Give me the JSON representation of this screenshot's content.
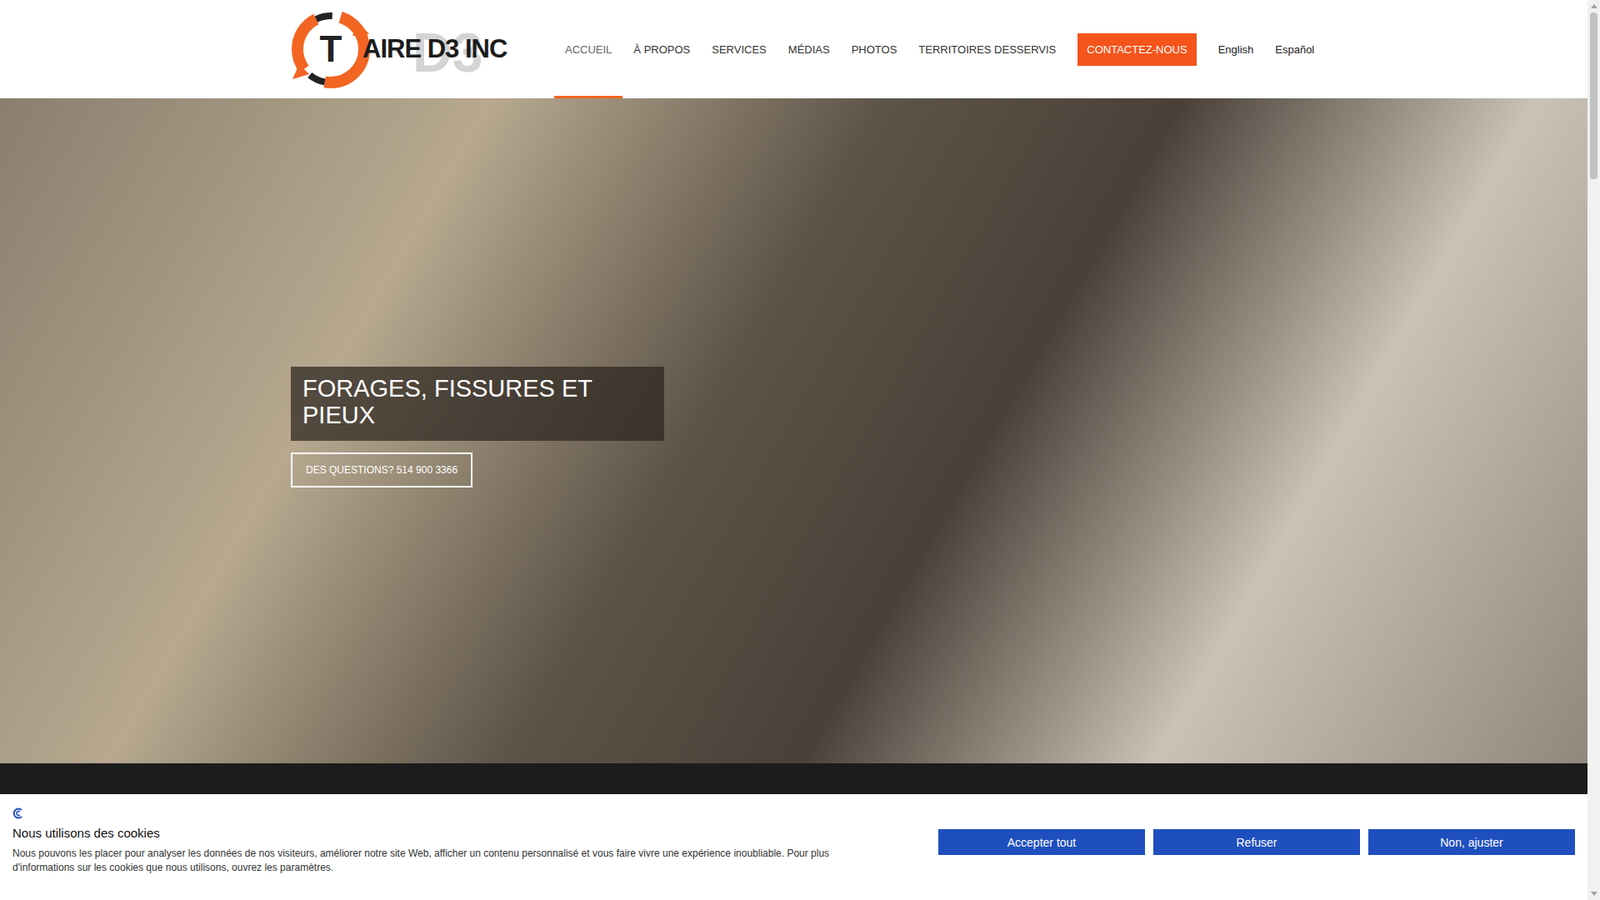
{
  "header": {
    "logo": {
      "mark": "T",
      "text": "AIRE D3 INC",
      "watermark": "D3"
    },
    "nav": [
      {
        "label": "ACCUEIL",
        "selected": true
      },
      {
        "label": "À PROPOS",
        "selected": false
      },
      {
        "label": "SERVICES",
        "selected": false
      },
      {
        "label": "MÉDIAS",
        "selected": false
      },
      {
        "label": "PHOTOS",
        "selected": false
      },
      {
        "label": "TERRITOIRES DESSERVIS",
        "selected": false
      }
    ],
    "cta": "CONTACTEZ-NOUS",
    "languages": [
      "English",
      "Español"
    ]
  },
  "hero": {
    "title": "FORAGES, FISSURES ET PIEUX",
    "button": "DES QUESTIONS? 514 900 3366"
  },
  "cookie_banner": {
    "title": "Nous utilisons des cookies",
    "text": "Nous pouvons les placer pour analyser les données de nos visiteurs, améliorer notre site Web, afficher un contenu personnalisé et vous faire vivre une expérience inoubliable. Pour plus d'informations sur les cookies que nous utilisons, ouvrez les paramètres.",
    "buttons": [
      "Accepter tout",
      "Refuser",
      "Non, ajuster"
    ]
  }
}
